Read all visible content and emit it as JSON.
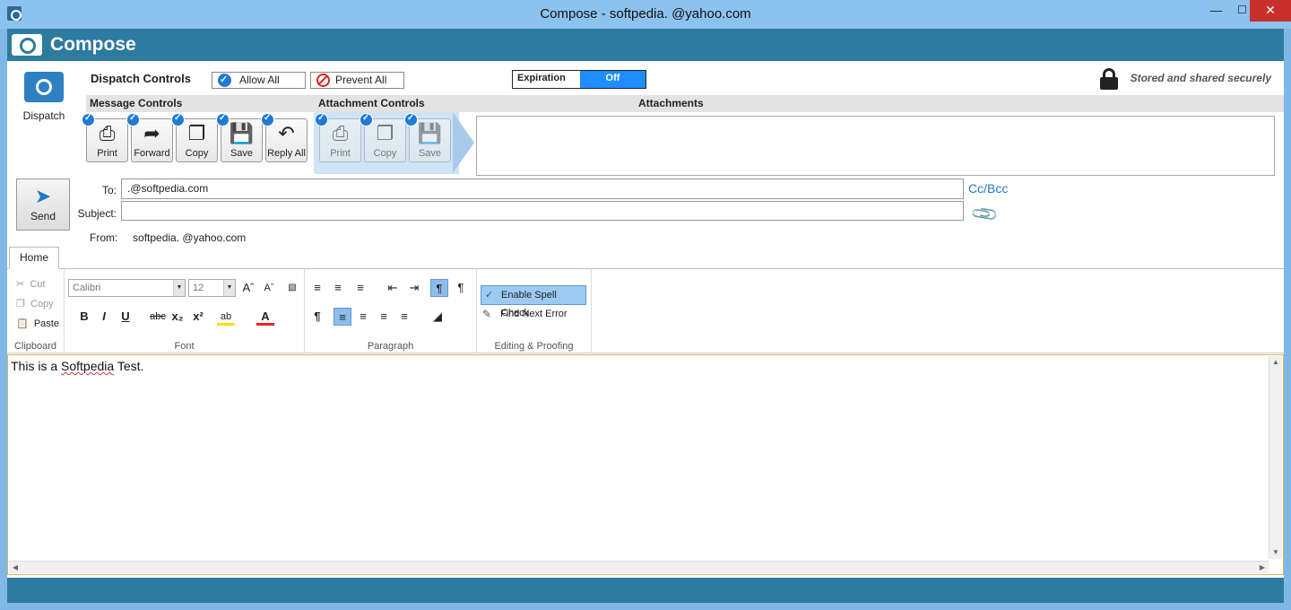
{
  "window": {
    "title": "Compose - softpedia.                  @yahoo.com",
    "minimize": "—",
    "maximize": "☐",
    "close": "✕"
  },
  "header": {
    "title": "Compose"
  },
  "dispatch": {
    "side_label": "Dispatch",
    "controls_label": "Dispatch Controls",
    "allow_all": "Allow All",
    "prevent_all": "Prevent All",
    "expiration_label": "Expiration",
    "expiration_value": "Off",
    "secure_text": "Stored and shared securely",
    "sections": {
      "message": "Message Controls",
      "attachment": "Attachment Controls",
      "attachments": "Attachments"
    },
    "message_buttons": [
      "Print",
      "Forward",
      "Copy",
      "Save",
      "Reply All"
    ],
    "attachment_buttons": [
      "Print",
      "Copy",
      "Save"
    ]
  },
  "compose": {
    "send_label": "Send",
    "to_label": "To:",
    "to_value": "                        .@softpedia.com",
    "subject_label": "Subject:",
    "subject_value": "",
    "ccbcc": "Cc/Bcc",
    "from_label": "From:",
    "from_value": "softpedia.               @yahoo.com"
  },
  "ribbon": {
    "tab": "Home",
    "clipboard": {
      "title": "Clipboard",
      "cut": "Cut",
      "copy": "Copy",
      "paste": "Paste"
    },
    "font": {
      "title": "Font",
      "family": "Calibri",
      "size": "12"
    },
    "paragraph": {
      "title": "Paragraph"
    },
    "editing": {
      "title": "Editing & Proofing",
      "spell": "Enable Spell Check",
      "find": "Find Next Error"
    }
  },
  "editor": {
    "text_before": "This is a ",
    "text_misspelled": "Softpedia",
    "text_after": " Test."
  }
}
